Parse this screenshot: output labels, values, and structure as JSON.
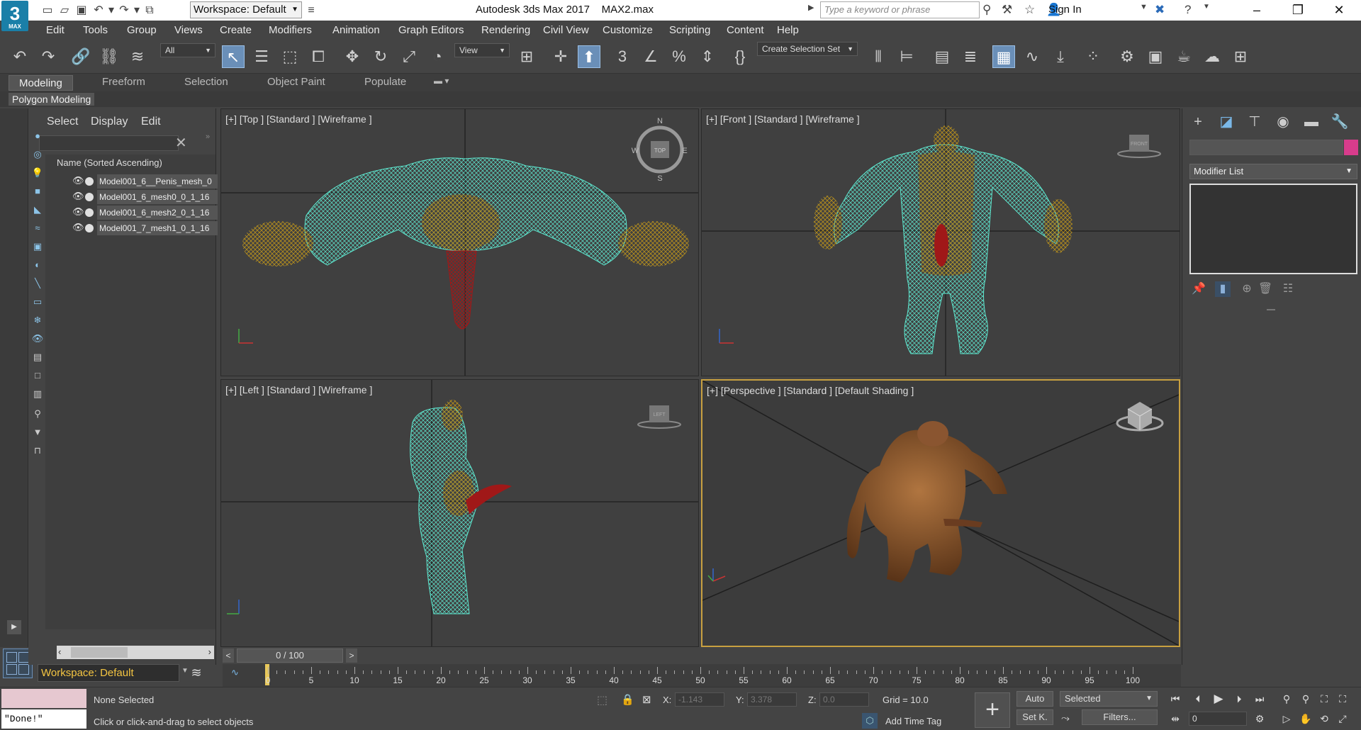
{
  "app": {
    "logo": "3",
    "logo_sub": "MAX",
    "title": "Autodesk 3ds Max 2017",
    "file": "MAX2.max",
    "workspace": "Workspace: Default",
    "search_placeholder": "Type a keyword or phrase",
    "sign_in": "Sign In"
  },
  "menu": [
    "Edit",
    "Tools",
    "Group",
    "Views",
    "Create",
    "Modifiers",
    "Animation",
    "Graph Editors",
    "Rendering",
    "Civil View",
    "Customize",
    "Scripting",
    "Content",
    "Help"
  ],
  "toolbar": {
    "filter_select": "All",
    "ref_coord_select": "View",
    "selection_set": "Create Selection Set"
  },
  "ribbon": {
    "tabs": [
      "Modeling",
      "Freeform",
      "Selection",
      "Object Paint",
      "Populate"
    ],
    "active_tab": "Modeling",
    "sub_label": "Polygon Modeling"
  },
  "explorer": {
    "tabs": [
      "Select",
      "Display",
      "Edit"
    ],
    "header": "Name (Sorted Ascending)",
    "items": [
      {
        "name": "Model001_6__Penis_mesh_0"
      },
      {
        "name": "Model001_6_mesh0_0_1_16"
      },
      {
        "name": "Model001_6_mesh2_0_1_16"
      },
      {
        "name": "Model001_7_mesh1_0_1_16"
      }
    ],
    "workspace": "Workspace: Default"
  },
  "viewports": {
    "top": "[+] [Top ] [Standard ] [Wireframe ]",
    "front": "[+] [Front ] [Standard ] [Wireframe ]",
    "left": "[+] [Left ] [Standard ] [Wireframe ]",
    "perspective": "[+] [Perspective ] [Standard ] [Default Shading ]",
    "top_cube": "TOP",
    "front_cube": "FRONT",
    "left_cube": "LEFT",
    "compass": {
      "n": "N",
      "s": "S",
      "e": "E",
      "w": "W"
    },
    "colors": {
      "wire_cyan": "#5ee8d0",
      "wire_gold": "#b8901c",
      "wire_red": "#a01818",
      "skin": "#8a5530"
    }
  },
  "command_panel": {
    "modifier_list": "Modifier List"
  },
  "timeline": {
    "slider": "0 / 100",
    "ticks": [
      "0",
      "5",
      "10",
      "15",
      "20",
      "25",
      "30",
      "35",
      "40",
      "45",
      "50",
      "55",
      "60",
      "65",
      "70",
      "75",
      "80",
      "85",
      "90",
      "95",
      "100"
    ]
  },
  "status": {
    "maxscript": "\"Done!\"",
    "selection": "None Selected",
    "prompt": "Click or click-and-drag to select objects",
    "x_label": "X:",
    "x_value": "-1.143",
    "y_label": "Y:",
    "y_value": "3.378",
    "z_label": "Z:",
    "z_value": "0.0",
    "grid": "Grid = 10.0",
    "add_time_tag": "Add Time Tag",
    "auto": "Auto",
    "set_key": "Set K.",
    "key_filter": "Selected",
    "filters": "Filters...",
    "frame": "0"
  }
}
